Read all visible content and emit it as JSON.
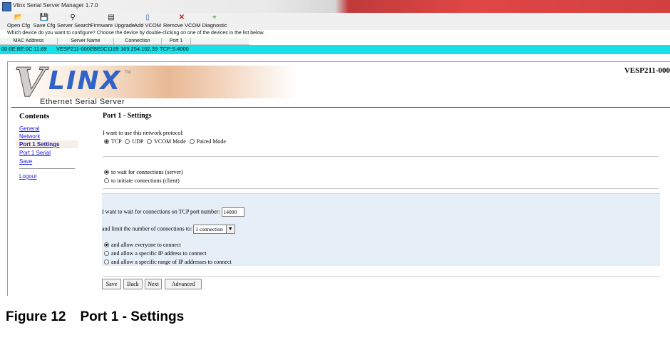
{
  "window": {
    "title": "Vlinx Serial Server Manager 1.7.0"
  },
  "toolbar": [
    {
      "label": "Open Cfg",
      "icon": "folder-open-icon",
      "glyph": "📂"
    },
    {
      "label": "Save Cfg",
      "icon": "save-icon",
      "glyph": "💾"
    },
    {
      "label": "Server Search",
      "icon": "search-icon",
      "glyph": "⚲"
    },
    {
      "label": "Firmware Upgrade",
      "icon": "firmware-upgrade-icon",
      "glyph": "▤"
    },
    {
      "label": "Add VCOM",
      "icon": "add-vcom-icon",
      "glyph": "▯"
    },
    {
      "label": "Remove VCOM",
      "icon": "remove-vcom-icon",
      "glyph": "✕"
    },
    {
      "label": "Diagnostic",
      "icon": "diagnostic-icon",
      "glyph": "⌖"
    }
  ],
  "hint": "Which device do you want to configure? Choose the device by double-clicking on one of the devices in the list below.",
  "device_list": {
    "columns": [
      "MAC Address",
      "Server Name",
      "Connection",
      "Port 1"
    ],
    "row": [
      "00:0E:BE:0C:11:69",
      "VESP211-000EBE0C1169",
      "169.254.102.39",
      "TCP:S:4000"
    ]
  },
  "banner": {
    "logo_v": "V",
    "logo_linx": "LINX",
    "logo_tm": "TM",
    "logo_subtitle": "Ethernet Serial Server",
    "product": "VESP211-000"
  },
  "sidebar": {
    "title": "Contents",
    "links": [
      "General",
      "Network",
      "Port 1 Settings",
      "Port 1 Serial",
      "Save"
    ],
    "logout": "Logout"
  },
  "content": {
    "title": "Port 1 - Settings",
    "protocol_prompt": "I want to use this network protocol:",
    "protocols": [
      "TCP",
      "UDP",
      "VCOM Mode",
      "Paired Mode"
    ],
    "protocol_selected": "TCP",
    "mode_options": [
      "to wait for connections (server)",
      "to initiate connections (client)"
    ],
    "mode_selected": 0,
    "port_label": "I want to wait for connections on TCP port number:",
    "port_value": "14000",
    "limit_label": "and limit the number of connections to:",
    "limit_value": "1 connection",
    "allow_options": [
      "and allow everyone to connect",
      "and allow a specific IP address to connect",
      "and allow a specific range of IP addresses to connect"
    ],
    "allow_selected": 0,
    "buttons": [
      "Save",
      "Back",
      "Next",
      "Advanced"
    ]
  },
  "caption": {
    "figure": "Figure 12",
    "title": "Port 1 - Settings"
  },
  "colors": {
    "selected_row": "#16e0e8",
    "link": "#1a1adf",
    "panel": "#e6eef8",
    "logo_blue": "#2f63c8"
  }
}
